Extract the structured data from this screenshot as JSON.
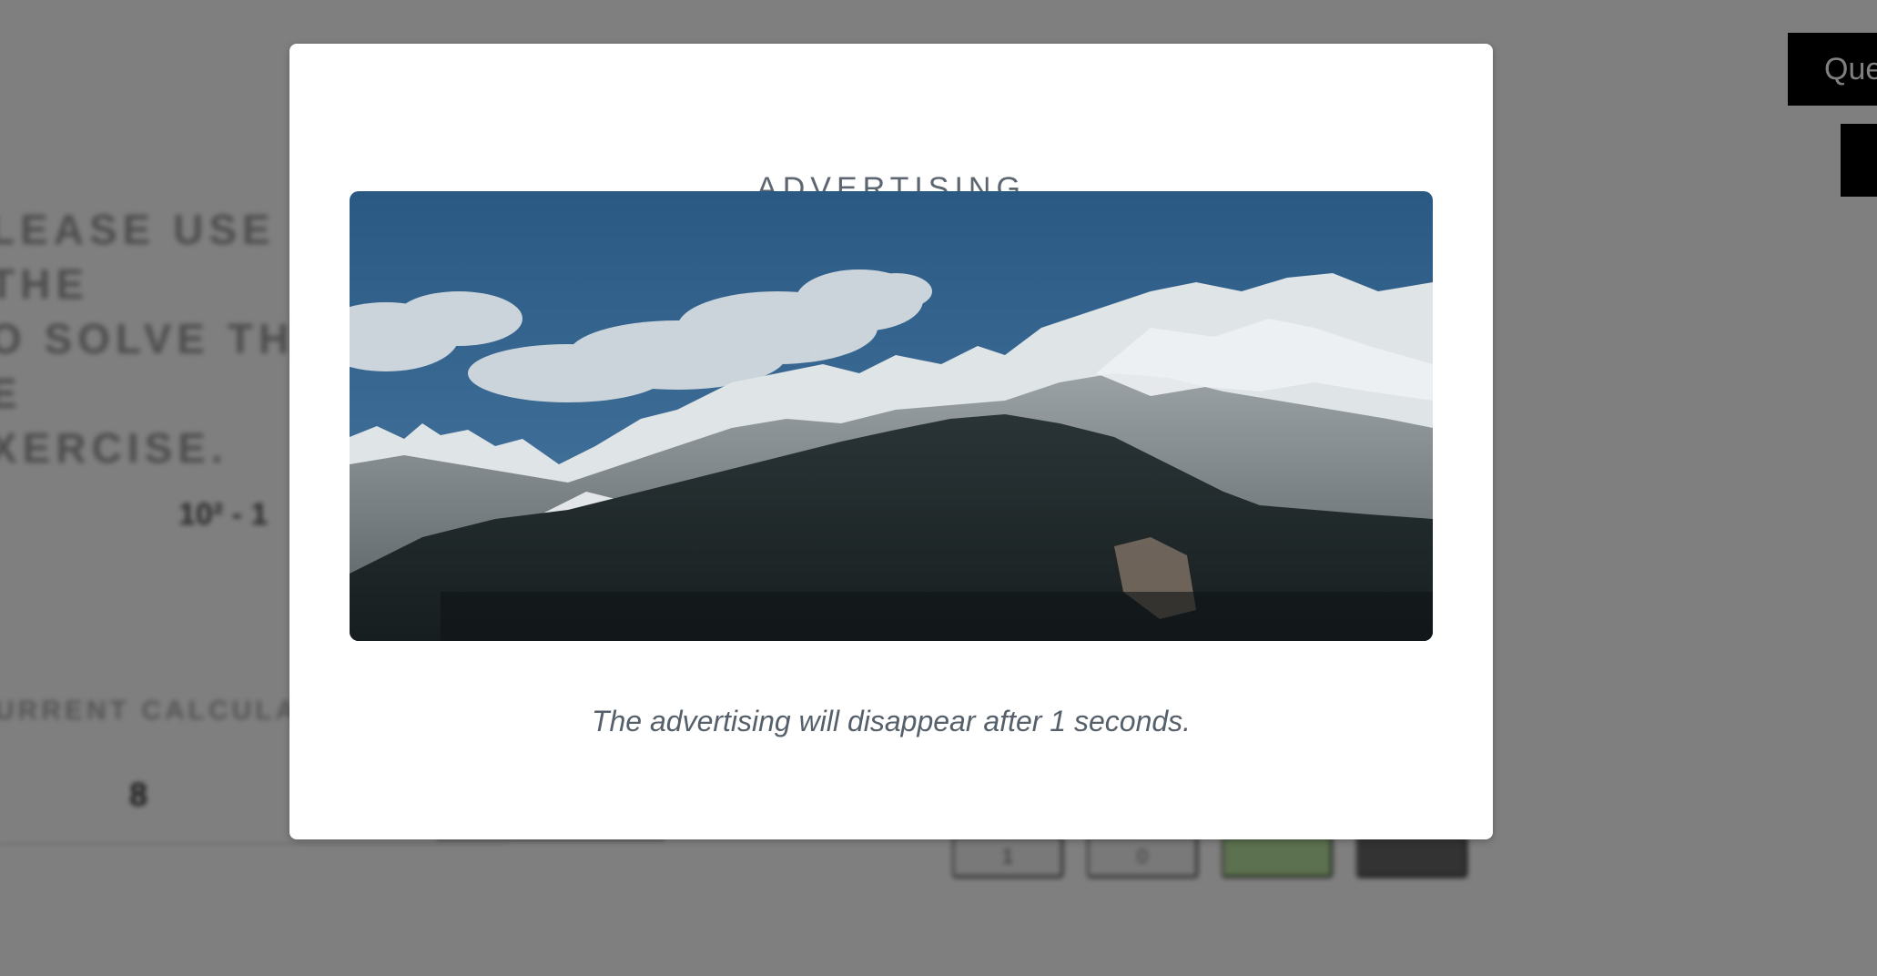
{
  "background": {
    "instructions_lines": [
      "LEASE USE THE",
      "O SOLVE THE E",
      "XERCISE."
    ],
    "expression": "10² - 1",
    "current_label": "URRENT CALCULATIO",
    "current_digit": "8",
    "buttons": [
      "1",
      "0",
      "",
      ""
    ],
    "question_button_label": "Que"
  },
  "modal": {
    "title": "ADVERTISING",
    "image_alt": "Snow-capped mountain range under a blue sky",
    "note": "The advertising will disappear after 1 seconds."
  },
  "colors": {
    "overlay": "rgba(0,0,0,0.5)",
    "modal_text": "#5d6670",
    "sky": "#2f5f88",
    "forest": "#1f2a2c",
    "snow": "#e8ecee"
  }
}
